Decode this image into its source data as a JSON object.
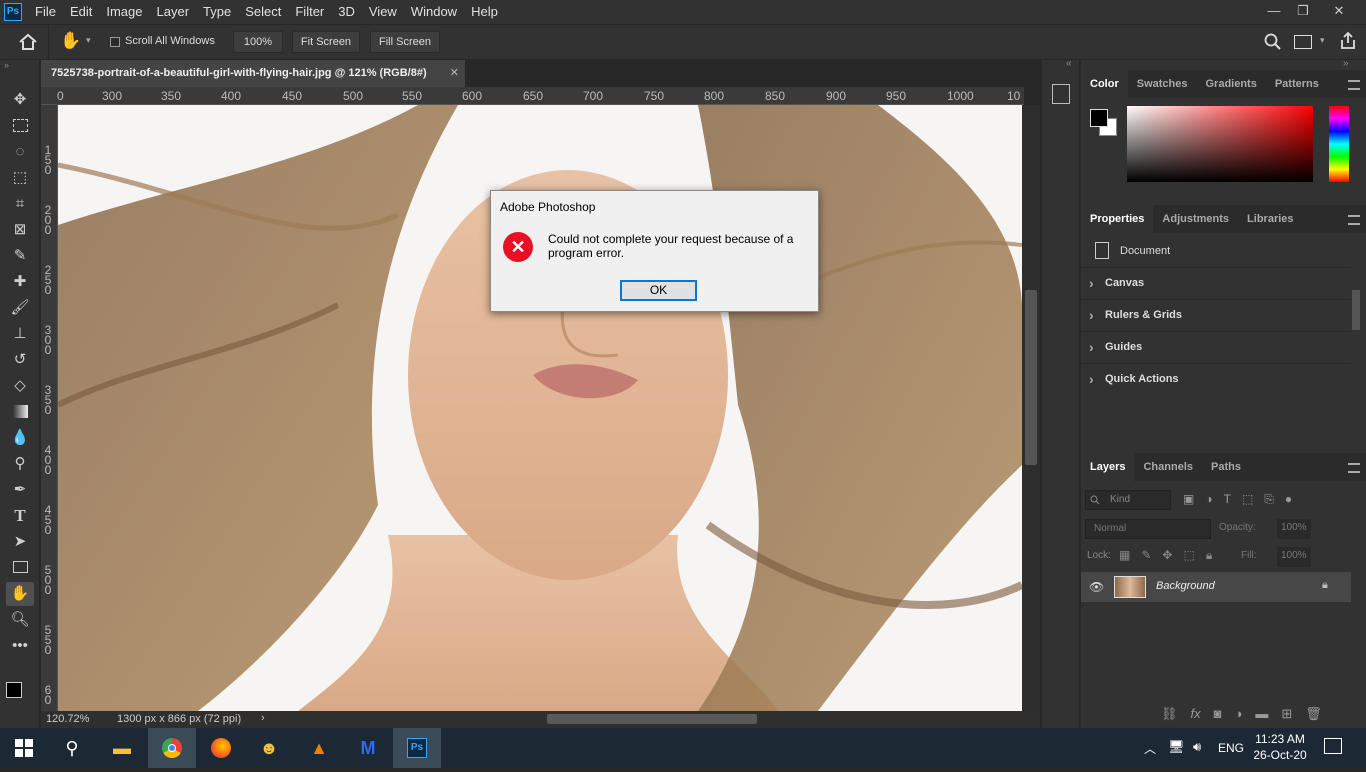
{
  "app": {
    "logo": "Ps"
  },
  "menu": [
    "File",
    "Edit",
    "Image",
    "Layer",
    "Type",
    "Select",
    "Filter",
    "3D",
    "View",
    "Window",
    "Help"
  ],
  "window_controls": {
    "minimize": "—",
    "restore": "❐",
    "close": "✕"
  },
  "options_bar": {
    "scroll_all_label": "Scroll All Windows",
    "zoom_btn": "100%",
    "fit_btn": "Fit Screen",
    "fill_btn": "Fill Screen"
  },
  "document": {
    "tab_title": "7525738-portrait-of-a-beautiful-girl-with-flying-hair.jpg @ 121% (RGB/8#)",
    "tab_close": "✕"
  },
  "ruler": {
    "h_ticks": [
      "0",
      "300",
      "350",
      "400",
      "450",
      "500",
      "550",
      "600",
      "650",
      "700",
      "750",
      "800",
      "850",
      "900",
      "950",
      "1000",
      "10"
    ],
    "v_ticks": [
      "1 5 0",
      "2 0 0",
      "2 5 0",
      "3 0 0",
      "3 5 0",
      "4 0 0",
      "4 5 0",
      "5 0 0",
      "5 5 0",
      "6 0"
    ]
  },
  "status": {
    "zoom": "120.72%",
    "doc_info": "1300 px x 866 px (72 ppi)",
    "arrow": "›"
  },
  "panels": {
    "color_tabs": [
      "Color",
      "Swatches",
      "Gradients",
      "Patterns"
    ],
    "properties_tabs": [
      "Properties",
      "Adjustments",
      "Libraries"
    ],
    "properties_doc": "Document",
    "properties_sections": [
      "Canvas",
      "Rulers & Grids",
      "Guides",
      "Quick Actions"
    ],
    "layers_tabs": [
      "Layers",
      "Channels",
      "Paths"
    ],
    "kind_placeholder": "Kind",
    "blend_mode": "Normal",
    "opacity_label": "Opacity:",
    "opacity_value": "100%",
    "lock_label": "Lock:",
    "fill_label": "Fill:",
    "fill_value": "100%",
    "layer_name": "Background"
  },
  "dialog": {
    "title": "Adobe Photoshop",
    "message": "Could not complete your request because of a program error.",
    "ok": "OK"
  },
  "taskbar": {
    "time": "11:23 AM",
    "date": "26-Oct-20",
    "lang": "ENG"
  },
  "colors": {
    "accent": "#31a8ff",
    "error": "#e81123",
    "bg": "#323232"
  }
}
